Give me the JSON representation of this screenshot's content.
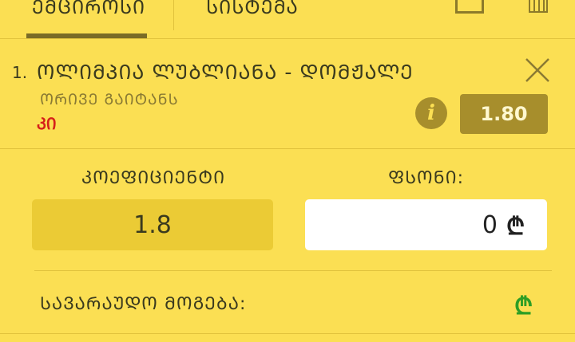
{
  "tabs": [
    {
      "label": "ᲔᲛᲪᲘᲠᲝᲡᲘ",
      "active": true
    },
    {
      "label": "ᲡᲘᲡᲢᲔᲛᲐ",
      "active": false
    }
  ],
  "header_icons": [
    "square-icon",
    "trash-icon"
  ],
  "bet": {
    "index": "1.",
    "match": "ᲝᲚᲘᲛᲞᲘᲐ ᲚᲣᲑᲚᲘᲐᲜᲐ - ᲓᲝᲛᲟᲐᲚᲔ",
    "market": "ᲝᲠᲘᲕᲔ ᲒᲐᲘᲢᲐᲜᲡ",
    "selection": "ᲙᲘ",
    "odds": "1.80",
    "info_symbol": "i"
  },
  "form": {
    "coefficient_label": "ᲙᲝᲔᲤᲘᲪᲘᲔᲜᲢᲘ",
    "coefficient_value": "1.8",
    "stake_label": "ᲤᲡᲝᲜᲘ:",
    "stake_value": "0",
    "currency_symbol": "₾"
  },
  "potential_win": {
    "label": "ᲡᲐᲕᲐᲠᲐᲣᲓᲝ ᲛᲝᲒᲔᲑᲐ:",
    "currency_symbol": "₾"
  },
  "colors": {
    "background": "#fbdf53",
    "accent": "#a78e2c",
    "selection": "#d6201a",
    "win_currency": "#2e9e25"
  }
}
